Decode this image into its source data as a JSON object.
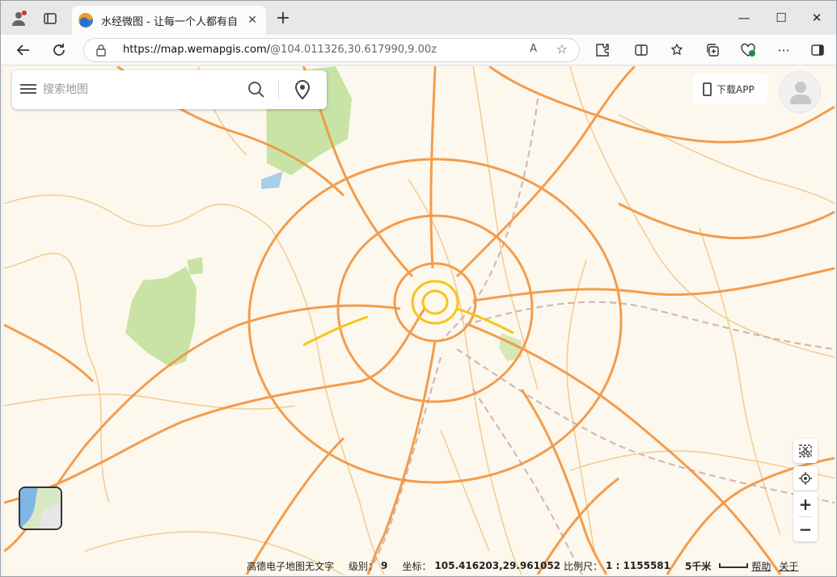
{
  "browser": {
    "tab_title": "水经微图 - 让每一个人都有自己的",
    "tab_close": "✕",
    "new_tab": "+",
    "window_controls": {
      "minimize": "—",
      "maximize": "☐",
      "close": "✕"
    }
  },
  "toolbar": {
    "url_host": "https://map.wemapgis.com/",
    "url_rest": "@104.011326,30.617990,9.00z",
    "read_aloud": "A",
    "favorite": "☆",
    "more": "···"
  },
  "search": {
    "placeholder": "搜索地图"
  },
  "download_app": "下载APP",
  "zoom": {
    "in": "+",
    "out": "−"
  },
  "status": {
    "layer_name": "高德电子地图无文字",
    "level_label": "级别：",
    "level_value": "9",
    "coord_label": "坐标：",
    "coord_value": "105.416203,29.961052",
    "scale_label": "比例尺：",
    "scale_value": "1 : 1155581",
    "scalebar_label": "5千米",
    "help": "帮助",
    "about": "关于"
  },
  "colors": {
    "map_bg": "#fdf8ee",
    "highway": "#f39540",
    "road": "#f2c98a",
    "green": "#c8e3a4"
  }
}
